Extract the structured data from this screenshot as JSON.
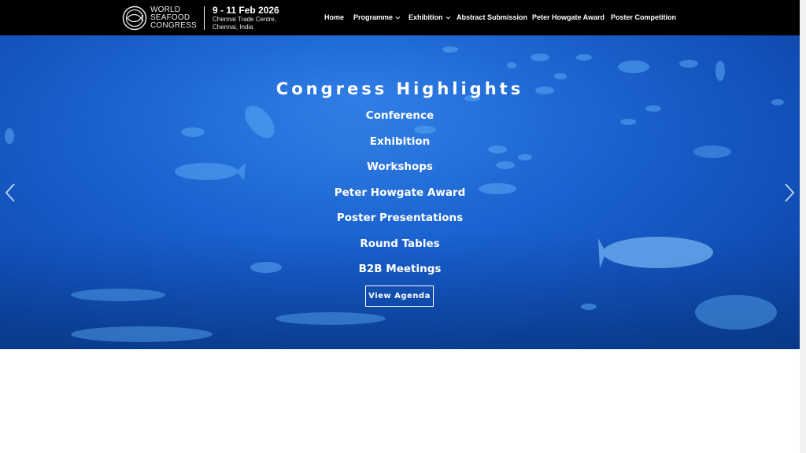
{
  "header": {
    "logo_lines": [
      "WORLD",
      "SEAFOOD",
      "CONGRESS"
    ],
    "event_date": "9 - 11 Feb 2026",
    "venue_line1": "Chennai Trade Centre,",
    "venue_line2": "Chennai, India"
  },
  "nav": {
    "items": [
      {
        "label": "Home"
      },
      {
        "label": "Programme",
        "icon": "chevron-down-icon"
      },
      {
        "label": "Exhibition",
        "icon": "chevron-down-icon"
      },
      {
        "label": "Abstract Submission"
      },
      {
        "label": "Peter Howgate Award"
      },
      {
        "label": "Poster Competition"
      }
    ]
  },
  "hero": {
    "title": "Congress Highlights",
    "highlights": [
      "Conference",
      "Exhibition",
      "Workshops",
      "Peter Howgate Award",
      "Poster Presentations",
      "Round Tables",
      "B2B Meetings"
    ],
    "cta_label": "View Agenda",
    "prev_icon": "chevron-left-icon",
    "next_icon": "chevron-right-icon"
  },
  "colors": {
    "header_bg": "#000000",
    "hero_blue": "#1a63d2",
    "text": "#ffffff"
  }
}
